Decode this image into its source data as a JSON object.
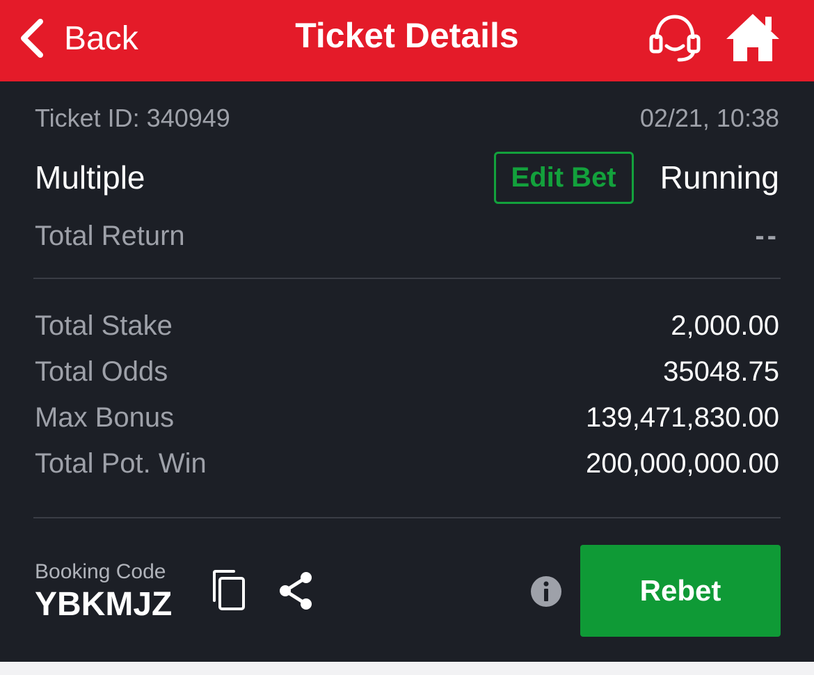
{
  "header": {
    "back_label": "Back",
    "title": "Ticket Details",
    "color": "#e41b29"
  },
  "icons": {
    "back": "chevron-left-icon",
    "support": "headset-icon",
    "home": "home-icon",
    "copy": "copy-icon",
    "share": "share-icon",
    "info": "info-icon"
  },
  "ticket": {
    "id_text": "Ticket ID: 340949",
    "datetime": "02/21, 10:38",
    "bet_type": "Multiple",
    "edit_label": "Edit Bet",
    "status": "Running",
    "total_return_label": "Total Return",
    "total_return_value": "--"
  },
  "summary": [
    {
      "label": "Total Stake",
      "value": "2,000.00"
    },
    {
      "label": "Total Odds",
      "value": "35048.75"
    },
    {
      "label": "Max Bonus",
      "value": "139,471,830.00"
    },
    {
      "label": "Total Pot. Win",
      "value": "200,000,000.00"
    }
  ],
  "booking": {
    "label": "Booking Code",
    "code": "YBKMJZ",
    "rebet_label": "Rebet"
  },
  "colors": {
    "background": "#1c1f26",
    "accent_green": "#0f9a36",
    "muted_text": "#9ea1a9"
  }
}
